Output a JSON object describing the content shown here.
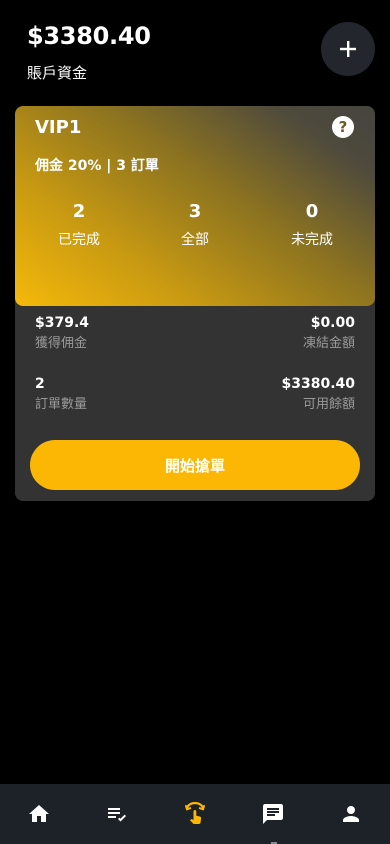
{
  "header": {
    "balance": "$3380.40",
    "balance_label": "賬戶資金"
  },
  "vip": {
    "title": "VIP1",
    "commission_text": "佣金 20% | 3 訂單",
    "stats": [
      {
        "value": "2",
        "label": "已完成"
      },
      {
        "value": "3",
        "label": "全部"
      },
      {
        "value": "0",
        "label": "未完成"
      }
    ]
  },
  "info": {
    "rows": [
      {
        "left_value": "$379.4",
        "left_caption": "獲得佣金",
        "right_value": "$0.00",
        "right_caption": "凍結金額"
      },
      {
        "left_value": "2",
        "left_caption": "訂單數量",
        "right_value": "$3380.40",
        "right_caption": "可用餘額"
      }
    ]
  },
  "start_button_label": "開始搶單",
  "colors": {
    "accent": "#fcb705",
    "nav_bg": "#1d2128",
    "card_bg": "#333333",
    "active_nav": "#fcb705"
  },
  "nav": {
    "items": [
      "home-icon",
      "task-list-icon",
      "grab-order-icon",
      "chat-icon",
      "profile-icon"
    ],
    "active": "grab-order-icon"
  }
}
